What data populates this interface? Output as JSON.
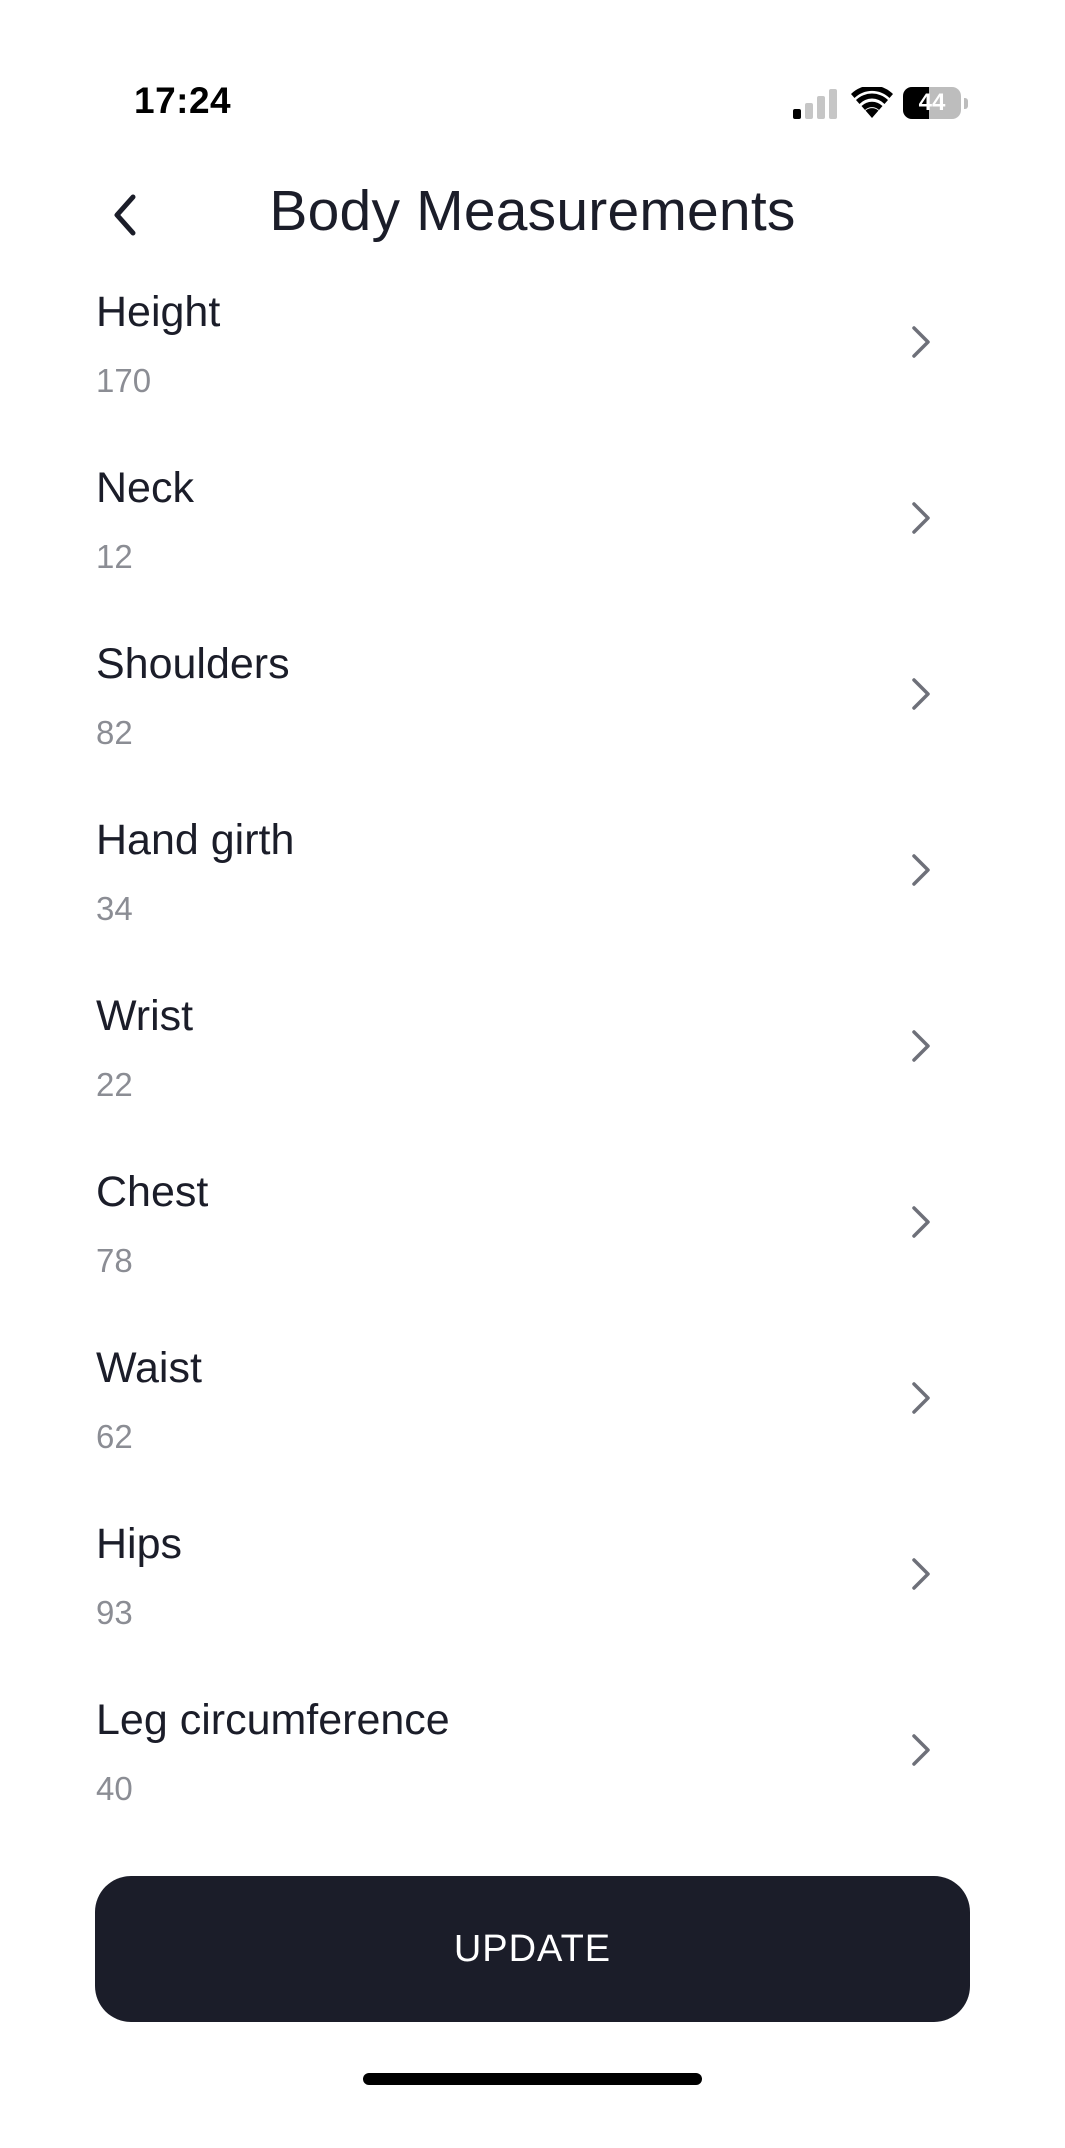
{
  "status_bar": {
    "time": "17:24",
    "battery_level": "44",
    "battery_fraction": 0.44,
    "icons": [
      "signal-icon",
      "wifi-icon",
      "battery-icon"
    ]
  },
  "header": {
    "title": "Body Measurements",
    "back_icon": "chevron-left-icon"
  },
  "measurements": [
    {
      "label": "Height",
      "value": "170"
    },
    {
      "label": "Neck",
      "value": "12"
    },
    {
      "label": "Shoulders",
      "value": "82"
    },
    {
      "label": "Hand girth",
      "value": "34"
    },
    {
      "label": "Wrist",
      "value": "22"
    },
    {
      "label": "Chest",
      "value": "78"
    },
    {
      "label": "Waist",
      "value": "62"
    },
    {
      "label": "Hips",
      "value": "93"
    },
    {
      "label": "Leg circumference",
      "value": "40"
    }
  ],
  "actions": {
    "update_label": "UPDATE"
  },
  "colors": {
    "primary_dark": "#1b1d29",
    "secondary_text": "#8b8d94",
    "chevron": "#6e7079",
    "background": "#ffffff"
  }
}
